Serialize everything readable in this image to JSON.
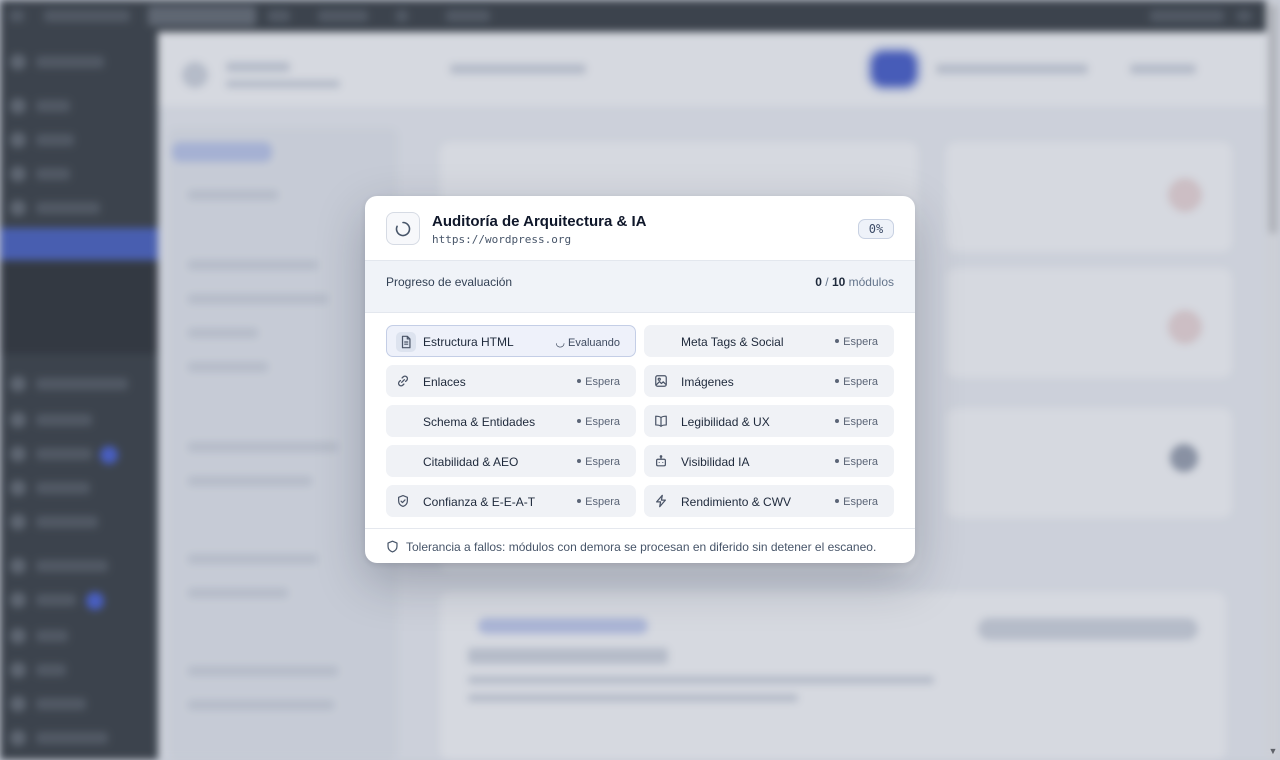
{
  "modal": {
    "title": "Auditoría de Arquitectura & IA",
    "url": "https://wordpress.org",
    "percent": "0%",
    "spinner_icon": "loading-spinner-icon"
  },
  "progress": {
    "label": "Progreso de evaluación",
    "done": "0",
    "separator": " / ",
    "total": "10",
    "unit": " módulos",
    "fraction": 0
  },
  "modules": [
    {
      "name": "Estructura HTML",
      "status": "Evaluando",
      "icon": "document-icon",
      "state": "active"
    },
    {
      "name": "Meta Tags & Social",
      "status": "Espera",
      "icon": "",
      "state": "waiting"
    },
    {
      "name": "Enlaces",
      "status": "Espera",
      "icon": "link-icon",
      "state": "waiting"
    },
    {
      "name": "Imágenes",
      "status": "Espera",
      "icon": "image-icon",
      "state": "waiting"
    },
    {
      "name": "Schema & Entidades",
      "status": "Espera",
      "icon": "",
      "state": "waiting"
    },
    {
      "name": "Legibilidad & UX",
      "status": "Espera",
      "icon": "book-icon",
      "state": "waiting"
    },
    {
      "name": "Citabilidad & AEO",
      "status": "Espera",
      "icon": "",
      "state": "waiting"
    },
    {
      "name": "Visibilidad IA",
      "status": "Espera",
      "icon": "bot-icon",
      "state": "waiting"
    },
    {
      "name": "Confianza & E-E-A-T",
      "status": "Espera",
      "icon": "shield-check-icon",
      "state": "waiting"
    },
    {
      "name": "Rendimiento & CWV",
      "status": "Espera",
      "icon": "lightning-icon",
      "state": "waiting"
    }
  ],
  "footer": {
    "text": "Tolerancia a fallos: módulos con demora se procesan en diferido sin detener el escaneo.",
    "icon": "shield-icon"
  },
  "colors": {
    "accent": "#2d47c4",
    "modal_bg": "#ffffff",
    "module_bg": "#f0f2f6",
    "active_border": "#c4cee6"
  }
}
